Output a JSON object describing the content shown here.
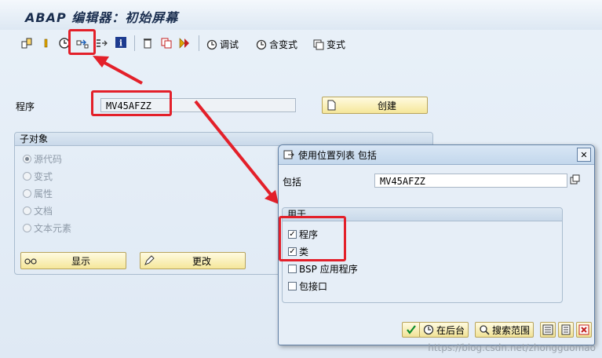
{
  "title": "ABAP 编辑器：初始屏幕",
  "toolbar": {
    "debug_label": "调试",
    "with_variant_label": "含变式",
    "variant_label": "变式"
  },
  "program": {
    "label": "程序",
    "value": "MV45AFZZ",
    "create_label": "创建"
  },
  "subobjects": {
    "header": "子对象",
    "options": [
      "源代码",
      "变式",
      "属性",
      "文档",
      "文本元素"
    ],
    "selected_index": 0,
    "display_label": "显示",
    "change_label": "更改"
  },
  "dialog": {
    "title": "使用位置列表 包括",
    "field_label": "包括",
    "field_value": "MV45AFZZ",
    "usedfor_header": "用于",
    "checks": [
      {
        "label": "程序",
        "checked": true
      },
      {
        "label": "类",
        "checked": true
      },
      {
        "label": "BSP 应用程序",
        "checked": false
      },
      {
        "label": "包接口",
        "checked": false
      }
    ],
    "background_label": "在后台",
    "search_scope_label": "搜索范围"
  },
  "watermark": "https://blog.csdn.net/zhongguomao",
  "colors": {
    "highlight": "#e3202a",
    "button": "#f5e79a"
  }
}
